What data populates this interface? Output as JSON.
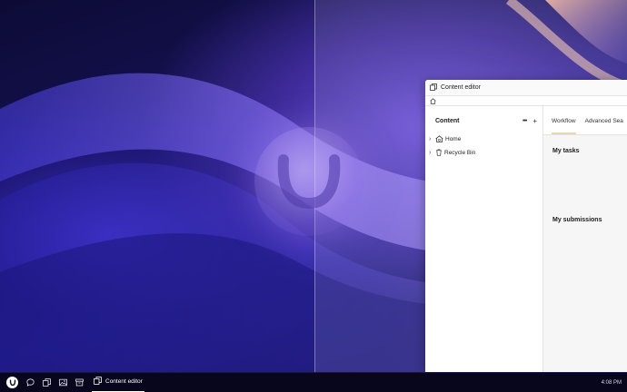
{
  "desktop": {
    "wallpaper": "umbraco-wave",
    "logo_icon": "umbraco-logo-icon"
  },
  "window": {
    "title": "Content editor",
    "title_icon": "pages-icon",
    "toolbar_icon": "home-icon",
    "tree": {
      "title": "Content",
      "more_label": "•••",
      "add_label": "+",
      "items": [
        {
          "label": "Home",
          "icon": "home-icon"
        },
        {
          "label": "Recycle Bin",
          "icon": "trash-icon"
        }
      ]
    },
    "tabs": [
      {
        "label": "Workflow",
        "active": true
      },
      {
        "label": "Advanced Sea",
        "active": false
      }
    ],
    "sections": {
      "tasks": "My tasks",
      "submissions": "My submissions"
    }
  },
  "taskbar": {
    "start_icon": "umbraco-logo-icon",
    "icons": [
      "chat-icon",
      "pages-icon",
      "image-icon",
      "archive-icon"
    ],
    "active_app": {
      "label": "Content editor",
      "icon": "pages-icon"
    },
    "clock": "4:08 PM"
  },
  "colors": {
    "accent_tab_underline": "#e8d6b4",
    "taskbar_bg": "#07061c"
  }
}
